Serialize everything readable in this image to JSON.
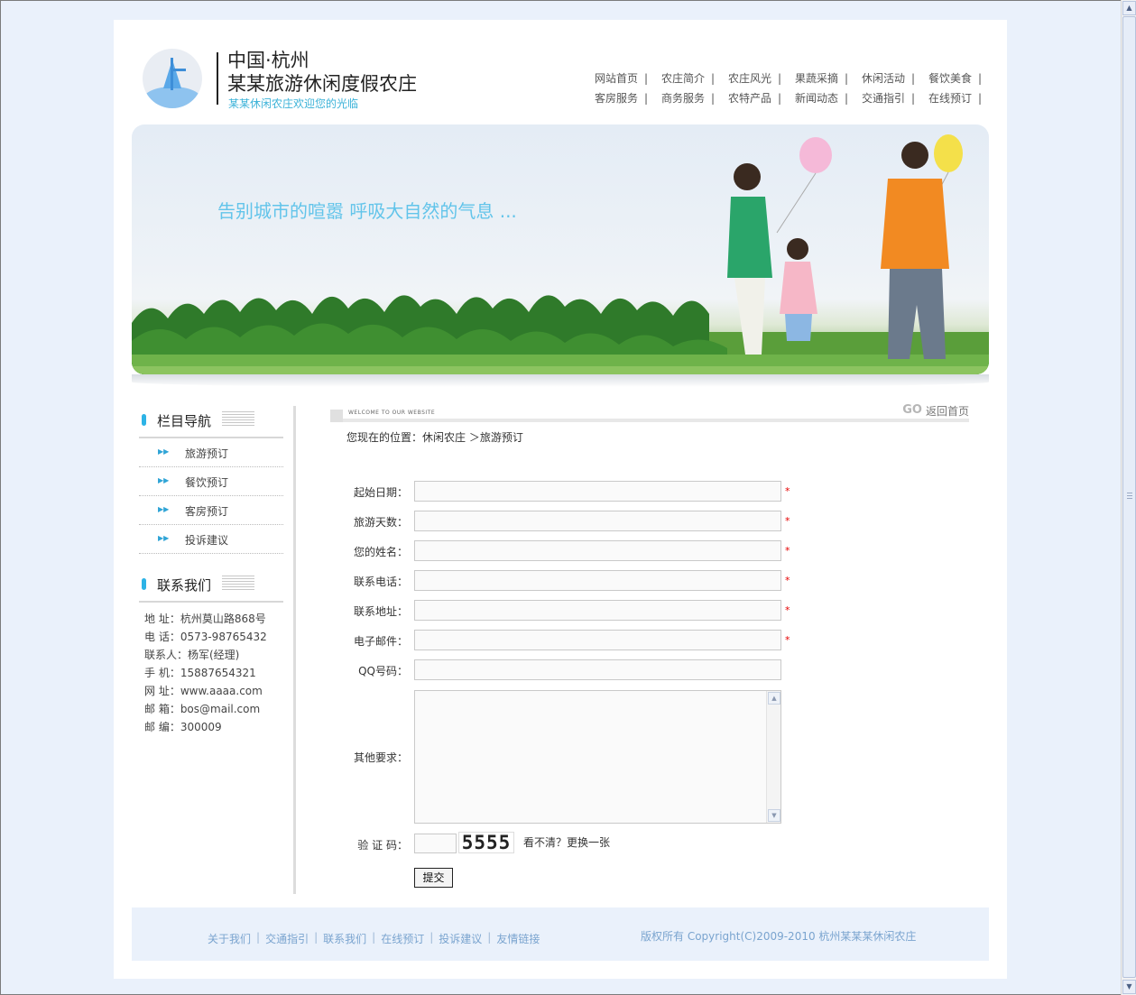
{
  "header": {
    "title_line1": "中国·杭州",
    "title_line2": "某某旅游休闲度假农庄",
    "subtitle": "某某休闲农庄欢迎您的光临"
  },
  "topnav": {
    "row1": [
      "网站首页",
      "农庄简介",
      "农庄风光",
      "果蔬采摘",
      "休闲活动",
      "餐饮美食"
    ],
    "row2": [
      "客房服务",
      "商务服务",
      "农特产品",
      "新闻动态",
      "交通指引",
      "在线预订"
    ]
  },
  "banner": {
    "slogan": "告别城市的喧嚣 呼吸大自然的气息 ..."
  },
  "sidebar": {
    "nav_title": "栏目导航",
    "nav_items": [
      "旅游预订",
      "餐饮预订",
      "客房预订",
      "投诉建议"
    ],
    "contact_title": "联系我们",
    "contact_lines": [
      "地 址：杭州莫山路868号",
      "电 话：0573-98765432",
      "联系人：杨军(经理)",
      "手 机：15887654321",
      "网 址：www.aaaa.com",
      "邮 箱：bos@mail.com",
      "邮 编：300009"
    ]
  },
  "main": {
    "welcome_text": "WELCOME TO OUR WEBSITE",
    "go_label": "GO",
    "back_home": "返回首页",
    "breadcrumb": "您现在的位置：休闲农庄 ＞旅游预订",
    "form": {
      "labels": [
        "起始日期：",
        "旅游天数：",
        "您的姓名：",
        "联系电话：",
        "联系地址：",
        "电子邮件：",
        "QQ号码："
      ],
      "required_mark": "*",
      "other_label": "其他要求：",
      "captcha_label": "验 证 码：",
      "captcha_code": "5555",
      "captcha_refresh": "看不清？更换一张",
      "submit_label": "提交"
    }
  },
  "footer": {
    "links": [
      "关于我们",
      "交通指引",
      "联系我们",
      "在线预订",
      "投诉建议",
      "友情链接"
    ],
    "separator": "|",
    "copyright": "版权所有  Copyright(C)2009-2010 杭州某某某休闲农庄"
  },
  "colors": {
    "page_bg": "#eaf1fb",
    "accent_cyan": "#2db3e6",
    "slogan": "#62c4ea",
    "required": "#e60000",
    "footer_link": "#7aa4cf"
  }
}
